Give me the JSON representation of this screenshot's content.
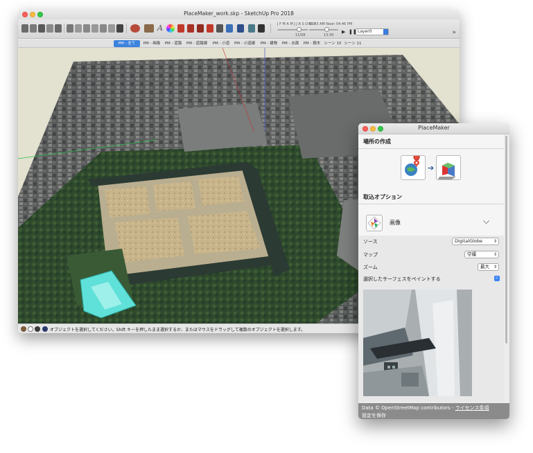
{
  "window": {
    "title": "PlaceMaker_work.skp - SketchUp Pro 2018",
    "layer": "Layer0",
    "date_label": "11/08",
    "time_label": "13:30",
    "date_scale_left": "J F M A M J J A S O N D",
    "time_scale": "06:43 AM  Noon  04:46 PM",
    "more_glyph": "»"
  },
  "scene_tabs": [
    "PM - 全て",
    "PM - 画像",
    "PM - 道路",
    "PM - 道路線",
    "PM - 小道",
    "PM - 小道線",
    "PM - 建物",
    "PM - 水面",
    "PM - 樹木",
    "シーン 10",
    "シーン 11"
  ],
  "status": {
    "text": "オブジェクトを選択してください。Shift キーを押したまま選択するか、またはマウスをドラッグして複数のオブジェクトを選択します。"
  },
  "panel": {
    "title": "PlaceMaker",
    "section_create": "場所の作成",
    "section_import": "取込オプション",
    "import_option": "画像",
    "chevron": "⌵",
    "source_label": "ソース",
    "source_value": "DigitalGlobe",
    "map_label": "マップ",
    "map_value": "空撮",
    "zoom_label": "ズーム",
    "zoom_value": "最大",
    "paint_label": "選択したサーフェスをペイントする",
    "paint_checked": true,
    "footer_data": "Data © OpenStreetMap contributors -",
    "footer_license": "ライセンス条項",
    "footer_save": "設定を保存"
  },
  "colors": {
    "accent": "#3c82de",
    "checkbox": "#3b82f6",
    "footer_bg": "#8b8b8b",
    "highlight_building": "#5fe0d8"
  }
}
